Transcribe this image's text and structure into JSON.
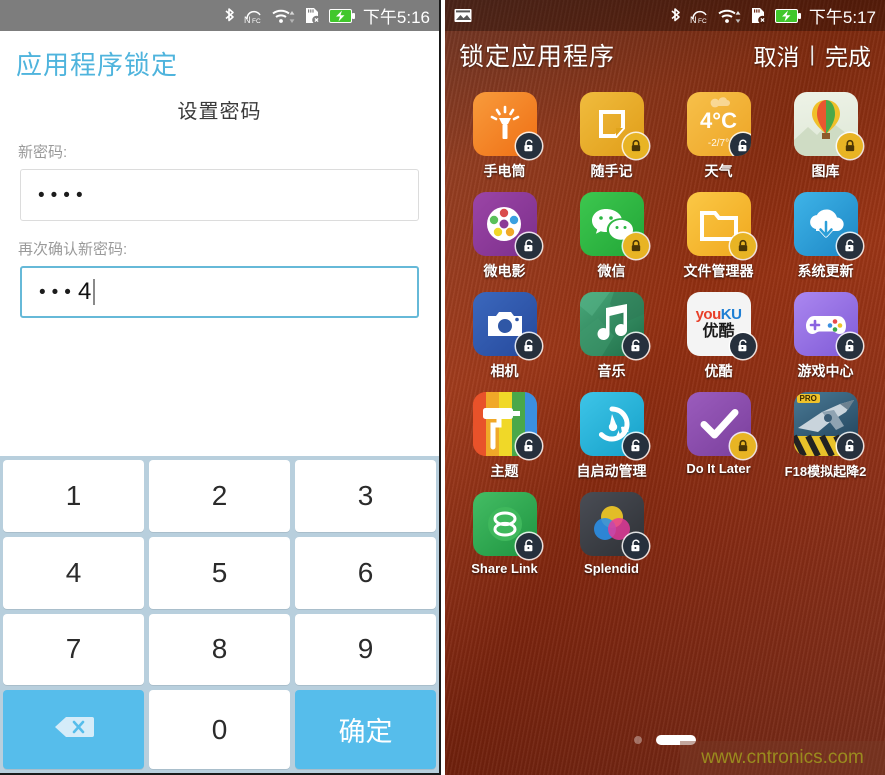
{
  "left_screen": {
    "statusbar": {
      "time": "下午5:16",
      "icons": [
        "bluetooth-icon",
        "nfc-icon",
        "wifi-icon",
        "sdcard-error-icon",
        "battery-charging-icon"
      ]
    },
    "app_title": "应用程序锁定",
    "section_title": "设置密码",
    "fields": [
      {
        "label": "新密码:",
        "value": "••••",
        "masked": true,
        "focused": false
      },
      {
        "label": "再次确认新密码:",
        "value": "•••",
        "visible_char": "4",
        "masked": true,
        "focused": true
      }
    ],
    "keypad": {
      "keys": [
        "1",
        "2",
        "3",
        "4",
        "5",
        "6",
        "7",
        "8",
        "9"
      ],
      "backspace_icon": "backspace-icon",
      "zero": "0",
      "confirm_label": "确定",
      "accent_color": "#56bdeb",
      "background_color": "#b8cfdd"
    }
  },
  "right_screen": {
    "statusbar": {
      "time": "下午5:17",
      "left_icon": "photo-notification-icon",
      "icons": [
        "bluetooth-icon",
        "nfc-icon",
        "wifi-icon",
        "sdcard-error-icon",
        "battery-charging-icon"
      ]
    },
    "header": {
      "title": "锁定应用程序",
      "cancel_label": "取消",
      "separator": "|",
      "done_label": "完成"
    },
    "apps": [
      {
        "name": "手电筒",
        "locked": false,
        "icon": "flashlight-icon",
        "bg": "#f07a1e",
        "latin": false
      },
      {
        "name": "随手记",
        "locked": true,
        "icon": "notes-icon",
        "bg": "#e8b02a",
        "latin": false
      },
      {
        "name": "天气",
        "locked": false,
        "icon": "weather-icon",
        "bg": "#f3b233",
        "latin": false,
        "temp": "4°C",
        "temp_range": "-2/7°"
      },
      {
        "name": "图库",
        "locked": true,
        "icon": "gallery-balloon-icon",
        "bg": "#eef2e6",
        "latin": false
      },
      {
        "name": "微电影",
        "locked": false,
        "icon": "film-reel-icon",
        "bg": "#8c3b96",
        "latin": false
      },
      {
        "name": "微信",
        "locked": true,
        "icon": "wechat-icon",
        "bg": "#2cb742",
        "latin": false
      },
      {
        "name": "文件管理器",
        "locked": true,
        "icon": "folder-icon",
        "bg": "#f5b932",
        "latin": false
      },
      {
        "name": "系统更新",
        "locked": false,
        "icon": "cloud-download-icon",
        "bg": "#2b9fd8",
        "latin": false
      },
      {
        "name": "相机",
        "locked": false,
        "icon": "camera-icon",
        "bg": "#2f57a6",
        "latin": false
      },
      {
        "name": "音乐",
        "locked": false,
        "icon": "music-note-icon",
        "bg": "#2f8f5c",
        "latin": false
      },
      {
        "name": "优酷",
        "locked": false,
        "icon": "youku-icon",
        "bg": "#f2f2f2",
        "latin": false,
        "brand_a": "you",
        "brand_b": "KU",
        "brand_cn": "优酷"
      },
      {
        "name": "游戏中心",
        "locked": false,
        "icon": "gamepad-icon",
        "bg": "#9a72e8",
        "latin": false
      },
      {
        "name": "主题",
        "locked": false,
        "icon": "paint-roller-icon",
        "bg": "#e8522a",
        "latin": false
      },
      {
        "name": "自启动管理",
        "locked": false,
        "icon": "autostart-gauge-icon",
        "bg": "#26b2d8",
        "latin": false
      },
      {
        "name": "Do It Later",
        "locked": true,
        "icon": "checkmark-icon",
        "bg": "#8c4fae",
        "latin": true
      },
      {
        "name": "F18模拟起降2",
        "locked": false,
        "icon": "jet-plane-icon",
        "bg": "#2b4a63",
        "latin": false,
        "badge_text": "PRO"
      },
      {
        "name": "Share Link",
        "locked": false,
        "icon": "share-link-icon",
        "bg": "#2fa84f",
        "latin": true
      },
      {
        "name": "Splendid",
        "locked": false,
        "icon": "color-circles-icon",
        "bg": "#3d4046",
        "latin": true
      }
    ],
    "pager": {
      "dots": 1,
      "active_pill": true
    },
    "watermark": "www.cntronics.com",
    "colors": {
      "wallpaper": "#a83613",
      "locked_badge": "#e8b424",
      "unlocked_badge": "#26303d"
    }
  }
}
